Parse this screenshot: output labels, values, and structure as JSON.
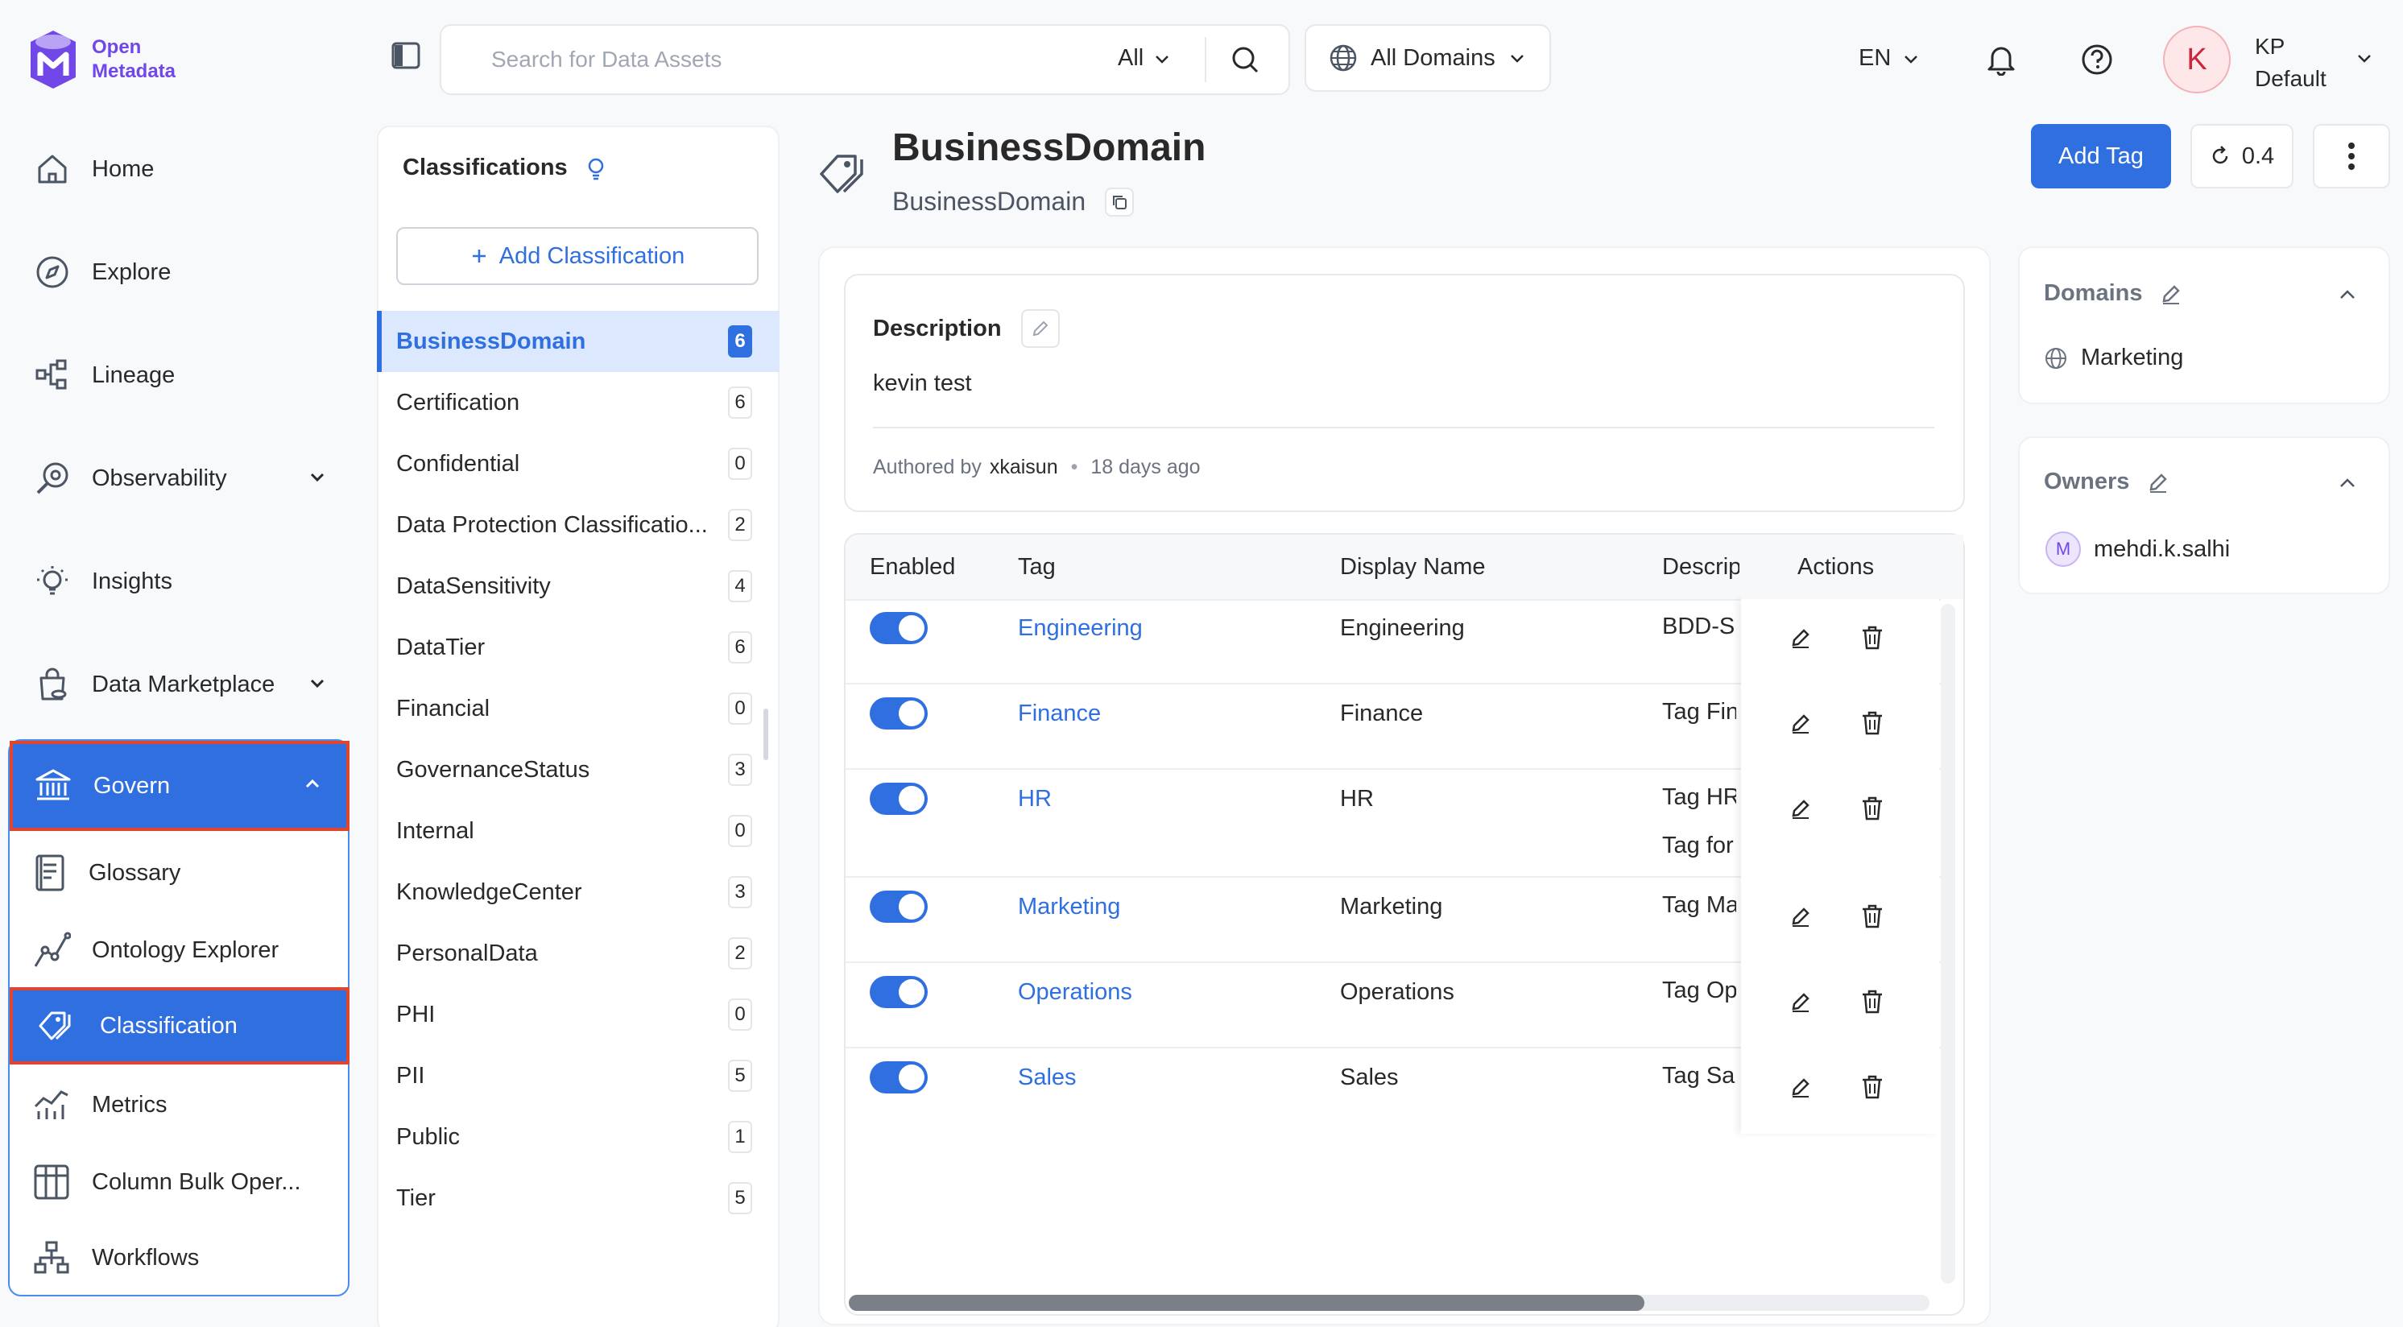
{
  "app": {
    "logo_line1": "Open",
    "logo_line2": "Metadata",
    "colors": {
      "accent": "#2f6fe0",
      "brand": "#7147e8",
      "highlight_border": "#e0452f"
    }
  },
  "sidebar": {
    "items": [
      {
        "label": "Home",
        "icon": "home-icon"
      },
      {
        "label": "Explore",
        "icon": "compass-icon"
      },
      {
        "label": "Lineage",
        "icon": "lineage-icon"
      },
      {
        "label": "Observability",
        "icon": "observability-icon"
      },
      {
        "label": "Insights",
        "icon": "lightbulb-icon"
      },
      {
        "label": "Data Marketplace",
        "icon": "marketplace-icon"
      }
    ],
    "govern": {
      "label": "Govern",
      "children": [
        {
          "label": "Glossary",
          "icon": "book-icon"
        },
        {
          "label": "Ontology Explorer",
          "icon": "graph-icon"
        },
        {
          "label": "Classification",
          "icon": "tags-icon"
        },
        {
          "label": "Metrics",
          "icon": "metrics-icon"
        },
        {
          "label": "Column Bulk Oper...",
          "icon": "table-icon"
        },
        {
          "label": "Workflows",
          "icon": "workflow-icon"
        }
      ]
    }
  },
  "topbar": {
    "search_placeholder": "Search for Data Assets",
    "search_scope": "All",
    "domains": "All Domains",
    "language": "EN",
    "user_initial": "K",
    "user_name": "KP",
    "user_role": "Default"
  },
  "classifications": {
    "title": "Classifications",
    "add_button": "Add Classification",
    "items": [
      {
        "name": "BusinessDomain",
        "count": "6",
        "active": true
      },
      {
        "name": "Certification",
        "count": "6"
      },
      {
        "name": "Confidential",
        "count": "0"
      },
      {
        "name": "Data Protection Classificatio...",
        "count": "2"
      },
      {
        "name": "DataSensitivity",
        "count": "4"
      },
      {
        "name": "DataTier",
        "count": "6"
      },
      {
        "name": "Financial",
        "count": "0"
      },
      {
        "name": "GovernanceStatus",
        "count": "3"
      },
      {
        "name": "Internal",
        "count": "0"
      },
      {
        "name": "KnowledgeCenter",
        "count": "3"
      },
      {
        "name": "PersonalData",
        "count": "2"
      },
      {
        "name": "PHI",
        "count": "0"
      },
      {
        "name": "PII",
        "count": "5"
      },
      {
        "name": "Public",
        "count": "1"
      },
      {
        "name": "Tier",
        "count": "5"
      }
    ]
  },
  "header": {
    "title": "BusinessDomain",
    "subtitle": "BusinessDomain",
    "add_tag": "Add Tag",
    "version": "0.4"
  },
  "description": {
    "label": "Description",
    "text": "kevin test",
    "authored_by_label": "Authored by",
    "author": "xkaisun",
    "time": "18 days ago"
  },
  "table": {
    "headers": {
      "enabled": "Enabled",
      "tag": "Tag",
      "display_name": "Display Name",
      "description": "Descrip",
      "actions": "Actions"
    },
    "rows": [
      {
        "tag": "Engineering",
        "display": "Engineering",
        "desc": "BDD-Su",
        "desc2": "",
        "enabled": true
      },
      {
        "tag": "Finance",
        "display": "Finance",
        "desc": "Tag Fin",
        "desc2": "",
        "enabled": true
      },
      {
        "tag": "HR",
        "display": "HR",
        "desc": "Tag HR",
        "desc2": "Tag for",
        "enabled": true
      },
      {
        "tag": "Marketing",
        "display": "Marketing",
        "desc": "Tag Ma",
        "desc2": "",
        "enabled": true
      },
      {
        "tag": "Operations",
        "display": "Operations",
        "desc": "Tag Op",
        "desc2": "",
        "enabled": true
      },
      {
        "tag": "Sales",
        "display": "Sales",
        "desc": "Tag Sal",
        "desc2": "",
        "enabled": true
      }
    ]
  },
  "right_panel": {
    "domains_title": "Domains",
    "domain_value": "Marketing",
    "owners_title": "Owners",
    "owner_initial": "M",
    "owner_name": "mehdi.k.salhi"
  }
}
